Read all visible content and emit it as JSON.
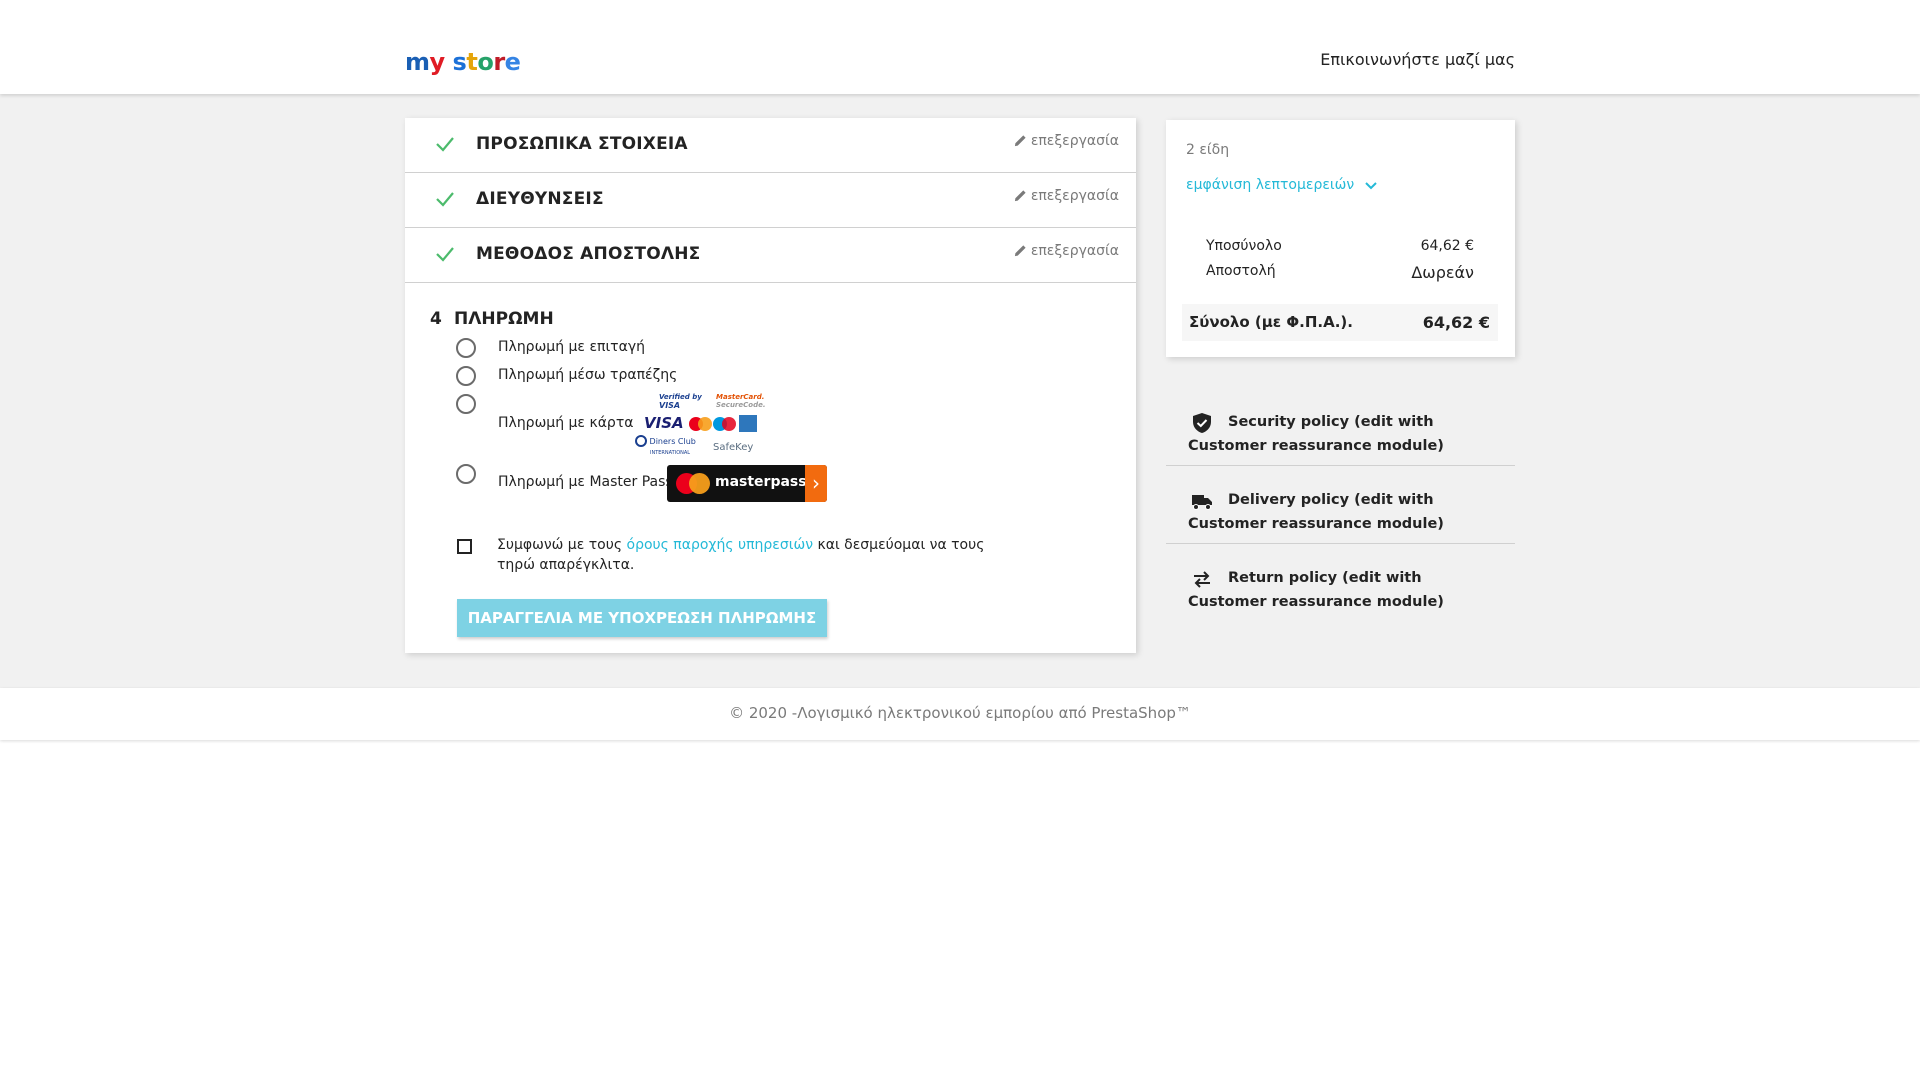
{
  "header": {
    "logo_text": "my store",
    "contact_link": "Επικοινωνήστε μαζί μας"
  },
  "checkout": {
    "edit_label": "επεξεργασία",
    "steps_done": [
      {
        "title": "ΠΡΟΣΩΠΙΚΑ ΣΤΟΙΧΕΙΑ"
      },
      {
        "title": "ΔΙΕΥΘΥΝΣΕΙΣ"
      },
      {
        "title": "ΜΕΘΟΔΟΣ ΑΠΟΣΤΟΛΗΣ"
      }
    ],
    "payment": {
      "number": "4",
      "title": "ΠΛΗΡΩΜΗ",
      "options": [
        {
          "label": "Πληρωμή με επιταγή"
        },
        {
          "label": "Πληρωμή μέσω τραπέζης"
        },
        {
          "label": "Πληρωμή με κάρτα"
        },
        {
          "label": "Πληρωμή με Master Pass"
        }
      ],
      "card_logos": {
        "verified_by": "Verified by",
        "visa_small": "VISA",
        "mastercard": "MasterCard.",
        "securecode": "SecureCode.",
        "visa": "VISA",
        "diners": "Diners Club",
        "diners_sub": "INTERNATIONAL",
        "safekey": "SafeKey"
      },
      "masterpass_button": "masterpass",
      "terms_before": "Συμφωνώ με τους ",
      "terms_link": "όρους παροχής υπηρεσιών",
      "terms_after": " και δεσμεύομαι να τους τηρώ απαρέγκλιτα.",
      "order_button": "ΠΑΡΑΓΓΕΛΙΑ ΜΕ ΥΠΟΧΡΕΩΣΗ ΠΛΗΡΩΜΗΣ"
    }
  },
  "summary": {
    "items_count": "2 είδη",
    "show_details": "εμφάνιση λεπτομερειών",
    "subtotal_label": "Υποσύνολο",
    "subtotal_value": "64,62 €",
    "shipping_label": "Αποστολή",
    "shipping_value": "Δωρεάν",
    "total_label": "Σύνολο (με Φ.Π.Α.).",
    "total_value": "64,62 €"
  },
  "reassurance": [
    {
      "icon": "shield-check-icon",
      "text": "Security policy (edit with Customer reassurance module)"
    },
    {
      "icon": "truck-icon",
      "text": "Delivery policy (edit with Customer reassurance module)"
    },
    {
      "icon": "swap-arrows-icon",
      "text": "Return policy (edit with Customer reassurance module)"
    }
  ],
  "footer": {
    "copyright": "© 2020 -Λογισμικό ηλεκτρονικού εμπορίου από PrestaShop™"
  },
  "colors": {
    "accent": "#24b9d7",
    "check_green": "#4cbb6c",
    "button_disabled": "#7ed2e4",
    "background": "#f1f1f1"
  }
}
